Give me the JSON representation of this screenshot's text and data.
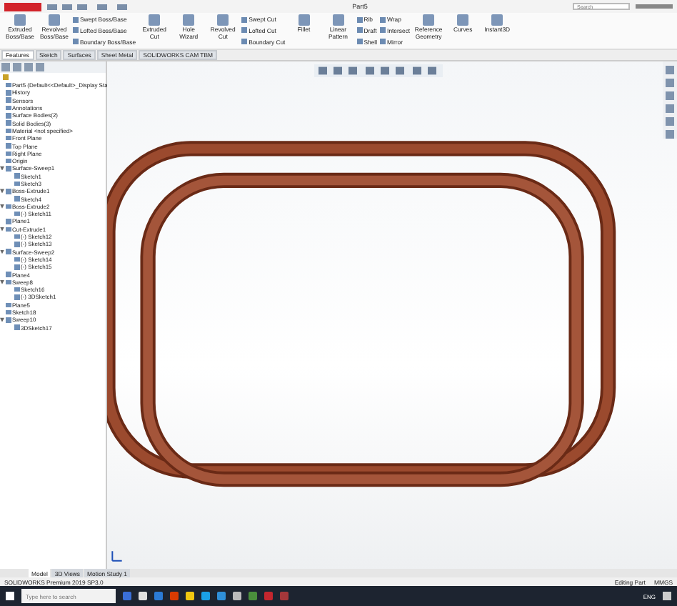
{
  "window": {
    "title": "Part5",
    "search_placeholder": "Search"
  },
  "ribbon": [
    {
      "kind": "large",
      "label": "Extruded Boss/Base"
    },
    {
      "kind": "large",
      "label": "Revolved Boss/Base"
    },
    {
      "kind": "stack",
      "items": [
        "Swept Boss/Base",
        "Lofted Boss/Base",
        "Boundary Boss/Base"
      ]
    },
    {
      "kind": "large",
      "label": "Extruded Cut"
    },
    {
      "kind": "large",
      "label": "Hole Wizard"
    },
    {
      "kind": "large",
      "label": "Revolved Cut"
    },
    {
      "kind": "stack",
      "items": [
        "Swept Cut",
        "Lofted Cut",
        "Boundary Cut"
      ]
    },
    {
      "kind": "large",
      "label": "Fillet"
    },
    {
      "kind": "large",
      "label": "Linear Pattern"
    },
    {
      "kind": "stack",
      "items": [
        "Rib",
        "Draft",
        "Shell"
      ]
    },
    {
      "kind": "stack",
      "items": [
        "Wrap",
        "Intersect",
        "Mirror"
      ]
    },
    {
      "kind": "large",
      "label": "Reference Geometry"
    },
    {
      "kind": "large",
      "label": "Curves"
    },
    {
      "kind": "large",
      "label": "Instant3D"
    }
  ],
  "tabs": [
    {
      "label": "Features",
      "selected": true
    },
    {
      "label": "Sketch",
      "selected": false
    },
    {
      "label": "Surfaces",
      "selected": false
    },
    {
      "label": "Sheet Metal",
      "selected": false
    },
    {
      "label": "SOLIDWORKS CAM TBM",
      "selected": false
    }
  ],
  "tree": [
    {
      "label": "Part5 (Default<<Default>_Display Sta"
    },
    {
      "label": "History"
    },
    {
      "label": "Sensors"
    },
    {
      "label": "Annotations"
    },
    {
      "label": "Surface Bodies(2)"
    },
    {
      "label": "Solid Bodies(3)"
    },
    {
      "label": "Material <not specified>"
    },
    {
      "label": "Front Plane"
    },
    {
      "label": "Top Plane"
    },
    {
      "label": "Right Plane"
    },
    {
      "label": "Origin"
    },
    {
      "label": "Surface-Sweep1",
      "expanded": true,
      "children": [
        {
          "label": "Sketch1"
        },
        {
          "label": "Sketch3"
        }
      ]
    },
    {
      "label": "Boss-Extrude1",
      "expanded": true,
      "children": [
        {
          "label": "Sketch4"
        }
      ]
    },
    {
      "label": "Boss-Extrude2",
      "expanded": true,
      "children": [
        {
          "label": "(-) Sketch11"
        }
      ]
    },
    {
      "label": "Plane1"
    },
    {
      "label": "Cut-Extrude1",
      "expanded": true,
      "children": [
        {
          "label": "(-) Sketch12"
        },
        {
          "label": "(-) Sketch13"
        }
      ]
    },
    {
      "label": "Surface-Sweep2",
      "expanded": true,
      "children": [
        {
          "label": "(-) Sketch14"
        },
        {
          "label": "(-) Sketch15"
        }
      ]
    },
    {
      "label": "Plane4"
    },
    {
      "label": "Sweep8",
      "expanded": true,
      "children": [
        {
          "label": "Sketch16"
        },
        {
          "label": "(-) 3DSketch1"
        }
      ]
    },
    {
      "label": "Plane5"
    },
    {
      "label": "Sketch18"
    },
    {
      "label": "Sweep10",
      "expanded": true,
      "children": [
        {
          "label": "3DSketch17"
        }
      ]
    }
  ],
  "bottom_tabs": [
    {
      "label": "Model",
      "selected": true
    },
    {
      "label": "3D Views",
      "selected": false
    },
    {
      "label": "Motion Study 1",
      "selected": false
    }
  ],
  "status": {
    "product": "SOLIDWORKS Premium 2019 SP3.0",
    "mode": "Editing Part",
    "units": "MMGS"
  },
  "taskbar": {
    "search_placeholder": "Type here to search",
    "language": "ENG"
  }
}
